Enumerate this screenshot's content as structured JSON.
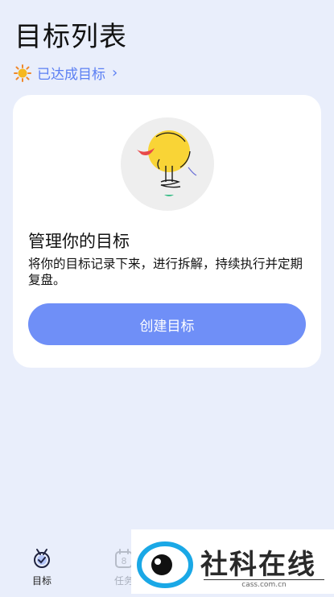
{
  "header": {
    "title": "目标列表"
  },
  "achieved": {
    "label": "已达成目标",
    "chevron": "›",
    "icon": "sun-icon"
  },
  "empty_state": {
    "title": "管理你的目标",
    "description": "将你的目标记录下来，进行拆解，持续执行并定期复盘。",
    "button_label": "创建目标",
    "illustration": "lightbulb-icon"
  },
  "tabbar": {
    "items": [
      {
        "label": "目标",
        "icon": "medal-icon",
        "active": true
      },
      {
        "label": "任务",
        "icon": "calendar-icon",
        "badge": "8",
        "active": false
      }
    ]
  },
  "watermark": {
    "text": "社科在线",
    "sub": "cass.com.cn"
  },
  "colors": {
    "accent": "#6f8ff7",
    "link": "#5b7ff3",
    "background": "#e9eefb",
    "bulb": "#f9d436"
  }
}
